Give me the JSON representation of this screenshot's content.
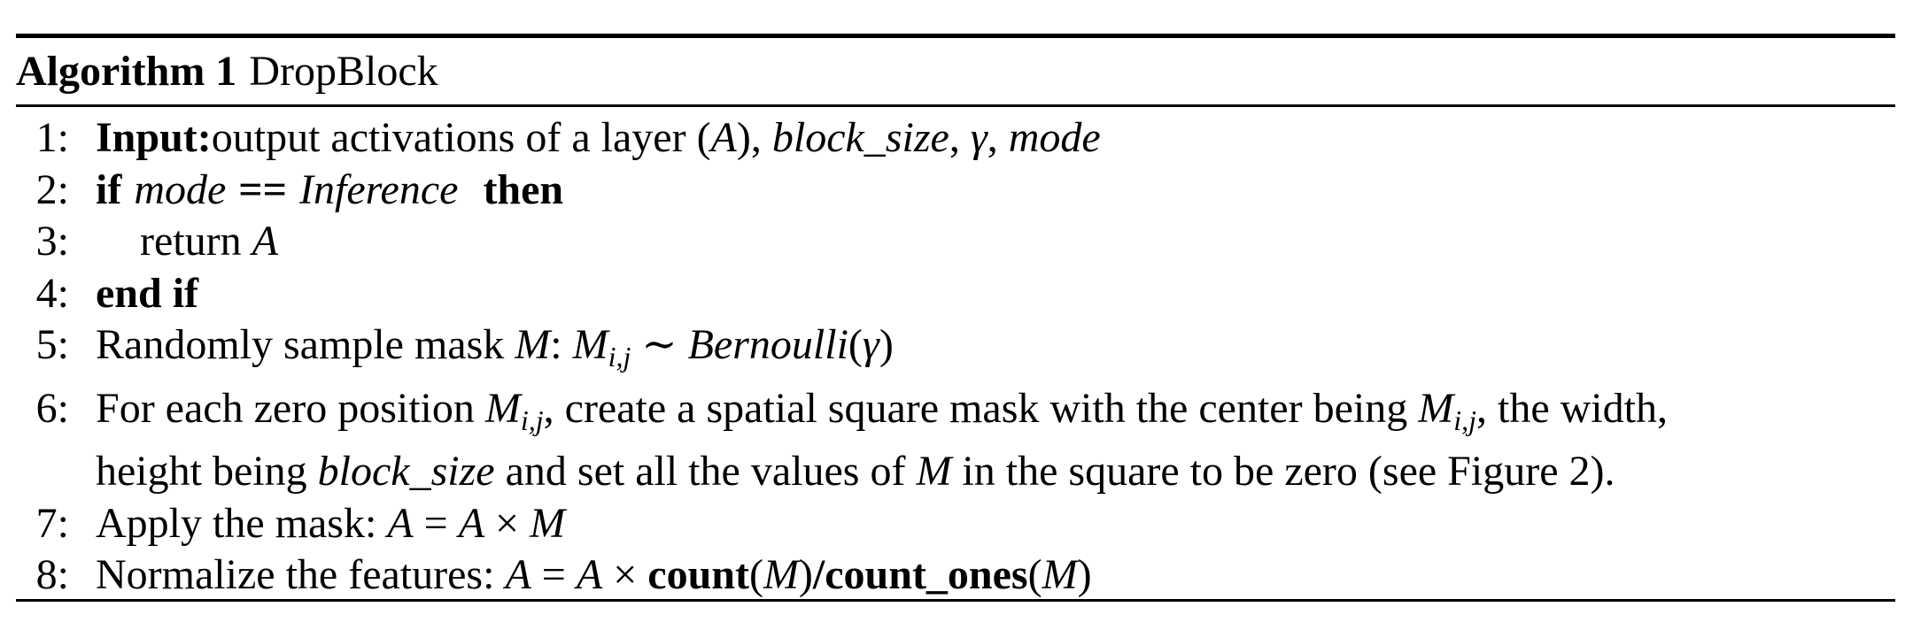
{
  "algorithm": {
    "label": "Algorithm 1",
    "title": "DropBlock"
  },
  "lines": [
    {
      "num": "1:",
      "keyword": "Input:",
      "text_a": "output activations of a layer (",
      "var_a": "A",
      "text_b": "), ",
      "param_1": "block_size",
      "sep_1": ", ",
      "param_2": "γ",
      "sep_2": ", ",
      "param_3": "mode"
    },
    {
      "num": "2:",
      "kw_if": "if",
      "var_mode": "mode",
      "op": "==",
      "inference": "Inference",
      "kw_then": "then"
    },
    {
      "num": "3:",
      "text": "return ",
      "var": "A"
    },
    {
      "num": "4:",
      "keyword": "end if"
    },
    {
      "num": "5:",
      "text": "Randomly sample mask ",
      "var_m": "M",
      "colon": ": ",
      "var_m2": "M",
      "sub": "i,j",
      "sim": " ∼ ",
      "dist": "Bernoulli",
      "arg_open": "(",
      "arg": "γ",
      "arg_close": ")"
    },
    {
      "num": "6:",
      "text_a": "For each zero position ",
      "var_m": "M",
      "sub_1": "i,j",
      "text_b": ", create a spatial square mask with the center being ",
      "var_m2": "M",
      "sub_2": "i,j",
      "text_c": ", the width,",
      "cont_a": "height being ",
      "cont_var": "block_size",
      "cont_b": " and set all the values of ",
      "cont_m": "M",
      "cont_c": " in the square to be zero (see Figure 2)."
    },
    {
      "num": "7:",
      "text": "Apply the mask: ",
      "lhs": "A",
      "eq": " = ",
      "rhs_a": "A",
      "times": " × ",
      "rhs_m": "M"
    },
    {
      "num": "8:",
      "text": "Normalize the features: ",
      "lhs": "A",
      "eq": " = ",
      "rhs_a": "A",
      "times": " × ",
      "fn_1": "count",
      "p1_open": "(",
      "p1_var": "M",
      "p1_close": ")",
      "slash": "/",
      "fn_2": "count_ones",
      "p2_open": "(",
      "p2_var": "M",
      "p2_close": ")"
    }
  ]
}
